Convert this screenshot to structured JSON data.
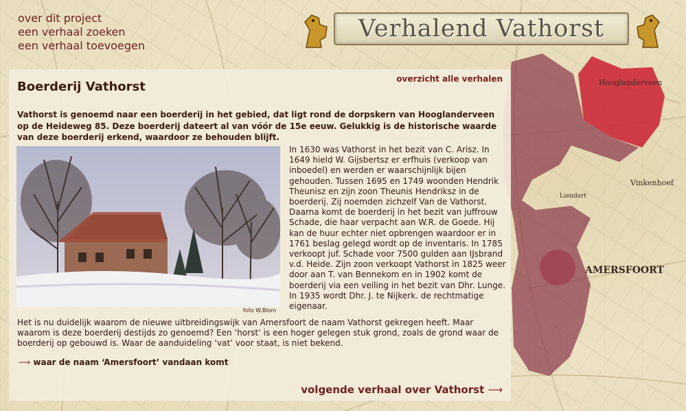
{
  "nav": {
    "items": [
      {
        "label": "over dit project"
      },
      {
        "label": "een verhaal zoeken"
      },
      {
        "label": "een verhaal toevoegen"
      }
    ]
  },
  "banner": {
    "title": "Verhalend Vathorst"
  },
  "map": {
    "labels": [
      "Hooglanderveen",
      "Vinkenhoef",
      "Liendert",
      "AMERSFOORT"
    ],
    "area_color": "#8b3a4c",
    "highlight_color": "#cc2a3a"
  },
  "content": {
    "title": "Boerderij Vathorst",
    "overview_link": "overzicht alle verhalen",
    "intro": "Vathorst is genoemd naar een boerderij in het gebied, dat ligt rond de dorpskern van Hooglanderveen op de Heideweg 85. Deze boerderij dateert al van vóór de 15e eeuw. Gelukkig is de historische waarde van deze boerderij erkend, waardoor ze behouden blijft.",
    "photo_caption": "foto W.Blom",
    "story": "In 1630 was Vathorst in het bezit van C. Arisz. In 1649 hield W. Gijsbertsz er erfhuis (verkoop van inboedel) en werden er waarschijnlijk bijen gehouden. Tussen 1695 en 1749 woonden Hendrik Theunisz en zijn zoon Theunis Hendriksz in de boerderij. Zij noemden zichzelf Van de Vathorst. Daarna komt de boerderij in het bezit van juffrouw Schade, die haar verpacht aan W.R. de Goede. Hij kan de huur echter niet opbrengen waardoor er in 1761 beslag gelegd wordt op de inventaris. In 1785 verkoopt juf. Schade voor 7500 gulden aan IJsbrand v.d. Heide. Zijn zoon verkoopt Vathorst in 1825 weer door aan T. van Bennekom en in 1902 komt de boerderij via een veiling in het bezit van Dhr. Lunge. In 1935 wordt Dhr. J. te Nijkerk. de rechtmatige eigenaar.",
    "closing": "Het is nu duidelijk waarom de nieuwe uitbreidingswijk van Amersfoort de naam Vathorst gekregen heeft. Maar waarom is deze boerderij destijds zo genoemd? Een ‘horst’ is een hoger gelegen stuk grond, zoals de grond waar de boerderij op gebouwd is. Waar de aanduideling ‘vat’ voor staat, is niet bekend.",
    "amersfoort_link": "waar de naam ‘Amersfoort’ vandaan komt",
    "next_link": "volgende verhaal over Vathorst",
    "arrow": "⟶"
  }
}
